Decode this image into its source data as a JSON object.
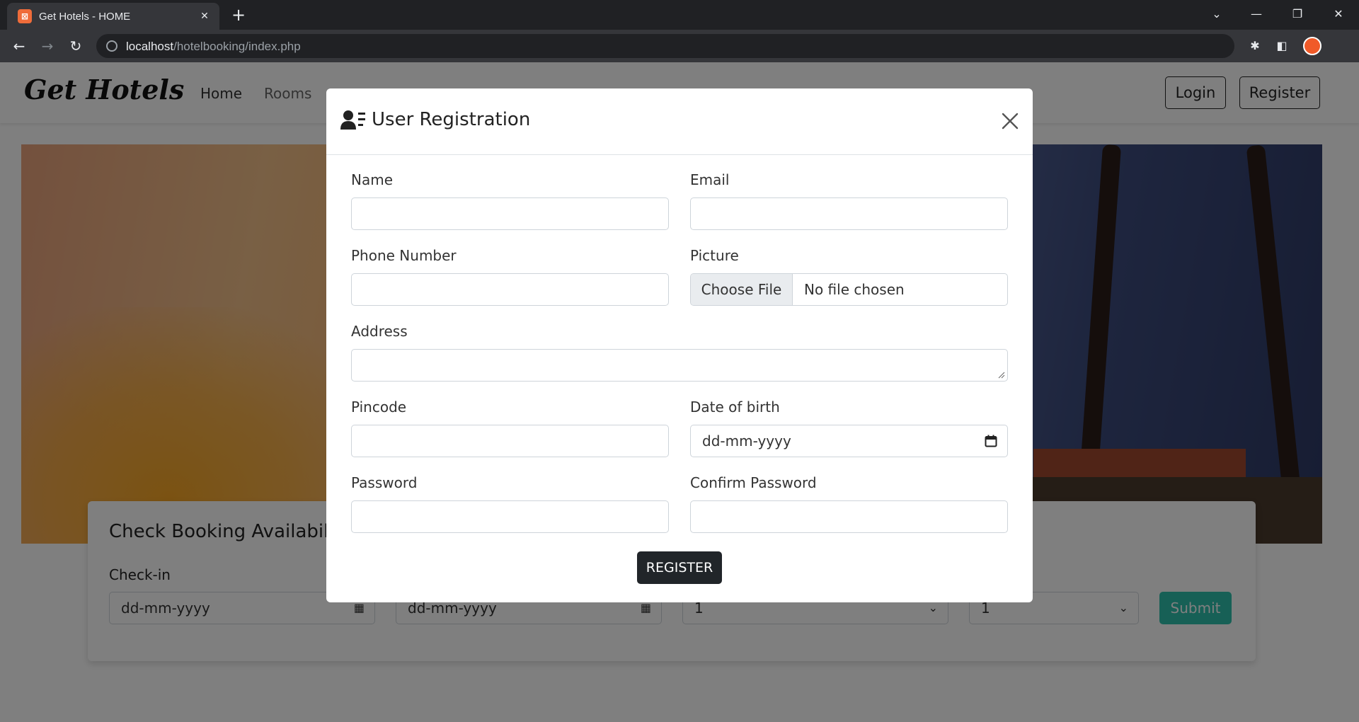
{
  "browser": {
    "tab_title": "Get Hotels - HOME",
    "url_host": "localhost",
    "url_path": "/hotelbooking/index.php"
  },
  "navbar": {
    "brand": "Get Hotels",
    "links": [
      "Home",
      "Rooms"
    ],
    "login_label": "Login",
    "register_label": "Register"
  },
  "booking": {
    "title": "Check Booking Availabili",
    "checkin_label": "Check-in",
    "checkin_value": "dd-mm-yyyy",
    "checkout_value": "dd-mm-yyyy",
    "adults_value": "1",
    "children_value": "1",
    "submit_label": "Submit"
  },
  "modal": {
    "title": "User Registration",
    "fields": {
      "name_label": "Name",
      "email_label": "Email",
      "phone_label": "Phone Number",
      "picture_label": "Picture",
      "file_button": "Choose File",
      "file_status": "No file chosen",
      "address_label": "Address",
      "pincode_label": "Pincode",
      "dob_label": "Date of birth",
      "dob_placeholder": "dd-mm-yyyy",
      "password_label": "Password",
      "confirm_password_label": "Confirm Password"
    },
    "submit_label": "REGISTER"
  },
  "colors": {
    "accent": "#2ec1ac",
    "dark_button": "#212529"
  }
}
